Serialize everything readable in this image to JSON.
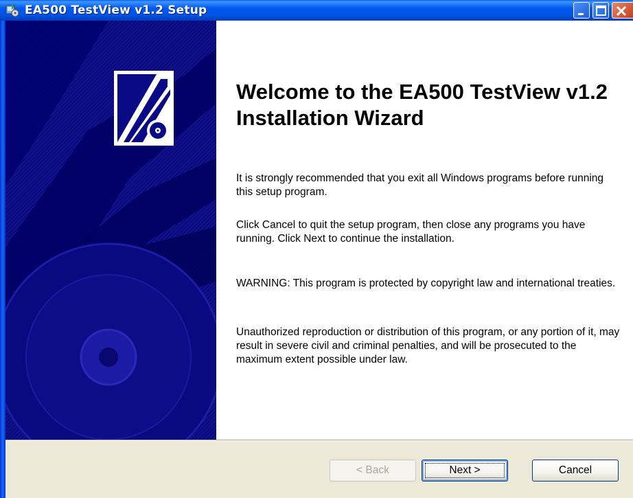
{
  "window": {
    "title": "EA500 TestView v1.2 Setup",
    "controls": [
      "minimize-icon",
      "maximize-icon",
      "close-icon"
    ]
  },
  "main": {
    "heading": "Welcome to the EA500 TestView v1.2 Installation Wizard",
    "paragraphs": [
      "It is strongly recommended that you exit all Windows programs before running this setup program.",
      "Click Cancel to quit the setup program, then close any programs you have running.  Click Next to continue the installation.",
      "WARNING: This program is protected by copyright law and international treaties.",
      "Unauthorized reproduction or distribution of this program, or any portion of it, may result in severe civil and criminal penalties, and will be prosecuted to the maximum extent possible under law."
    ]
  },
  "buttons": {
    "back": "< Back",
    "next": "Next >",
    "cancel": "Cancel"
  },
  "colors": {
    "titlebar": "#0058ee",
    "banner": "#0a0a86",
    "dialog_face": "#ece9d8",
    "close_button": "#d8512e"
  }
}
